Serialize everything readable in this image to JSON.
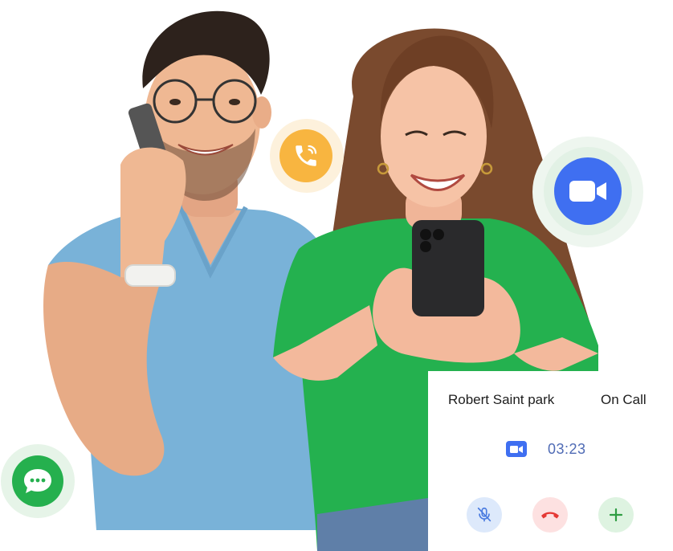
{
  "call": {
    "caller_name": "Robert Saint park",
    "status": "On Call",
    "timer": "03:23"
  },
  "icons": {
    "phone": "phone-ringing-icon",
    "video": "video-camera-icon",
    "chat": "chat-bubble-icon",
    "mute": "microphone-off-icon",
    "end_call": "phone-hangup-icon",
    "add": "plus-icon"
  },
  "colors": {
    "phone_accent": "#f8b540",
    "video_accent": "#3f6ff1",
    "chat_accent": "#25b04e",
    "end_call_red": "#e53935",
    "add_green": "#2f9d43",
    "mute_blue": "#4a7be0"
  }
}
